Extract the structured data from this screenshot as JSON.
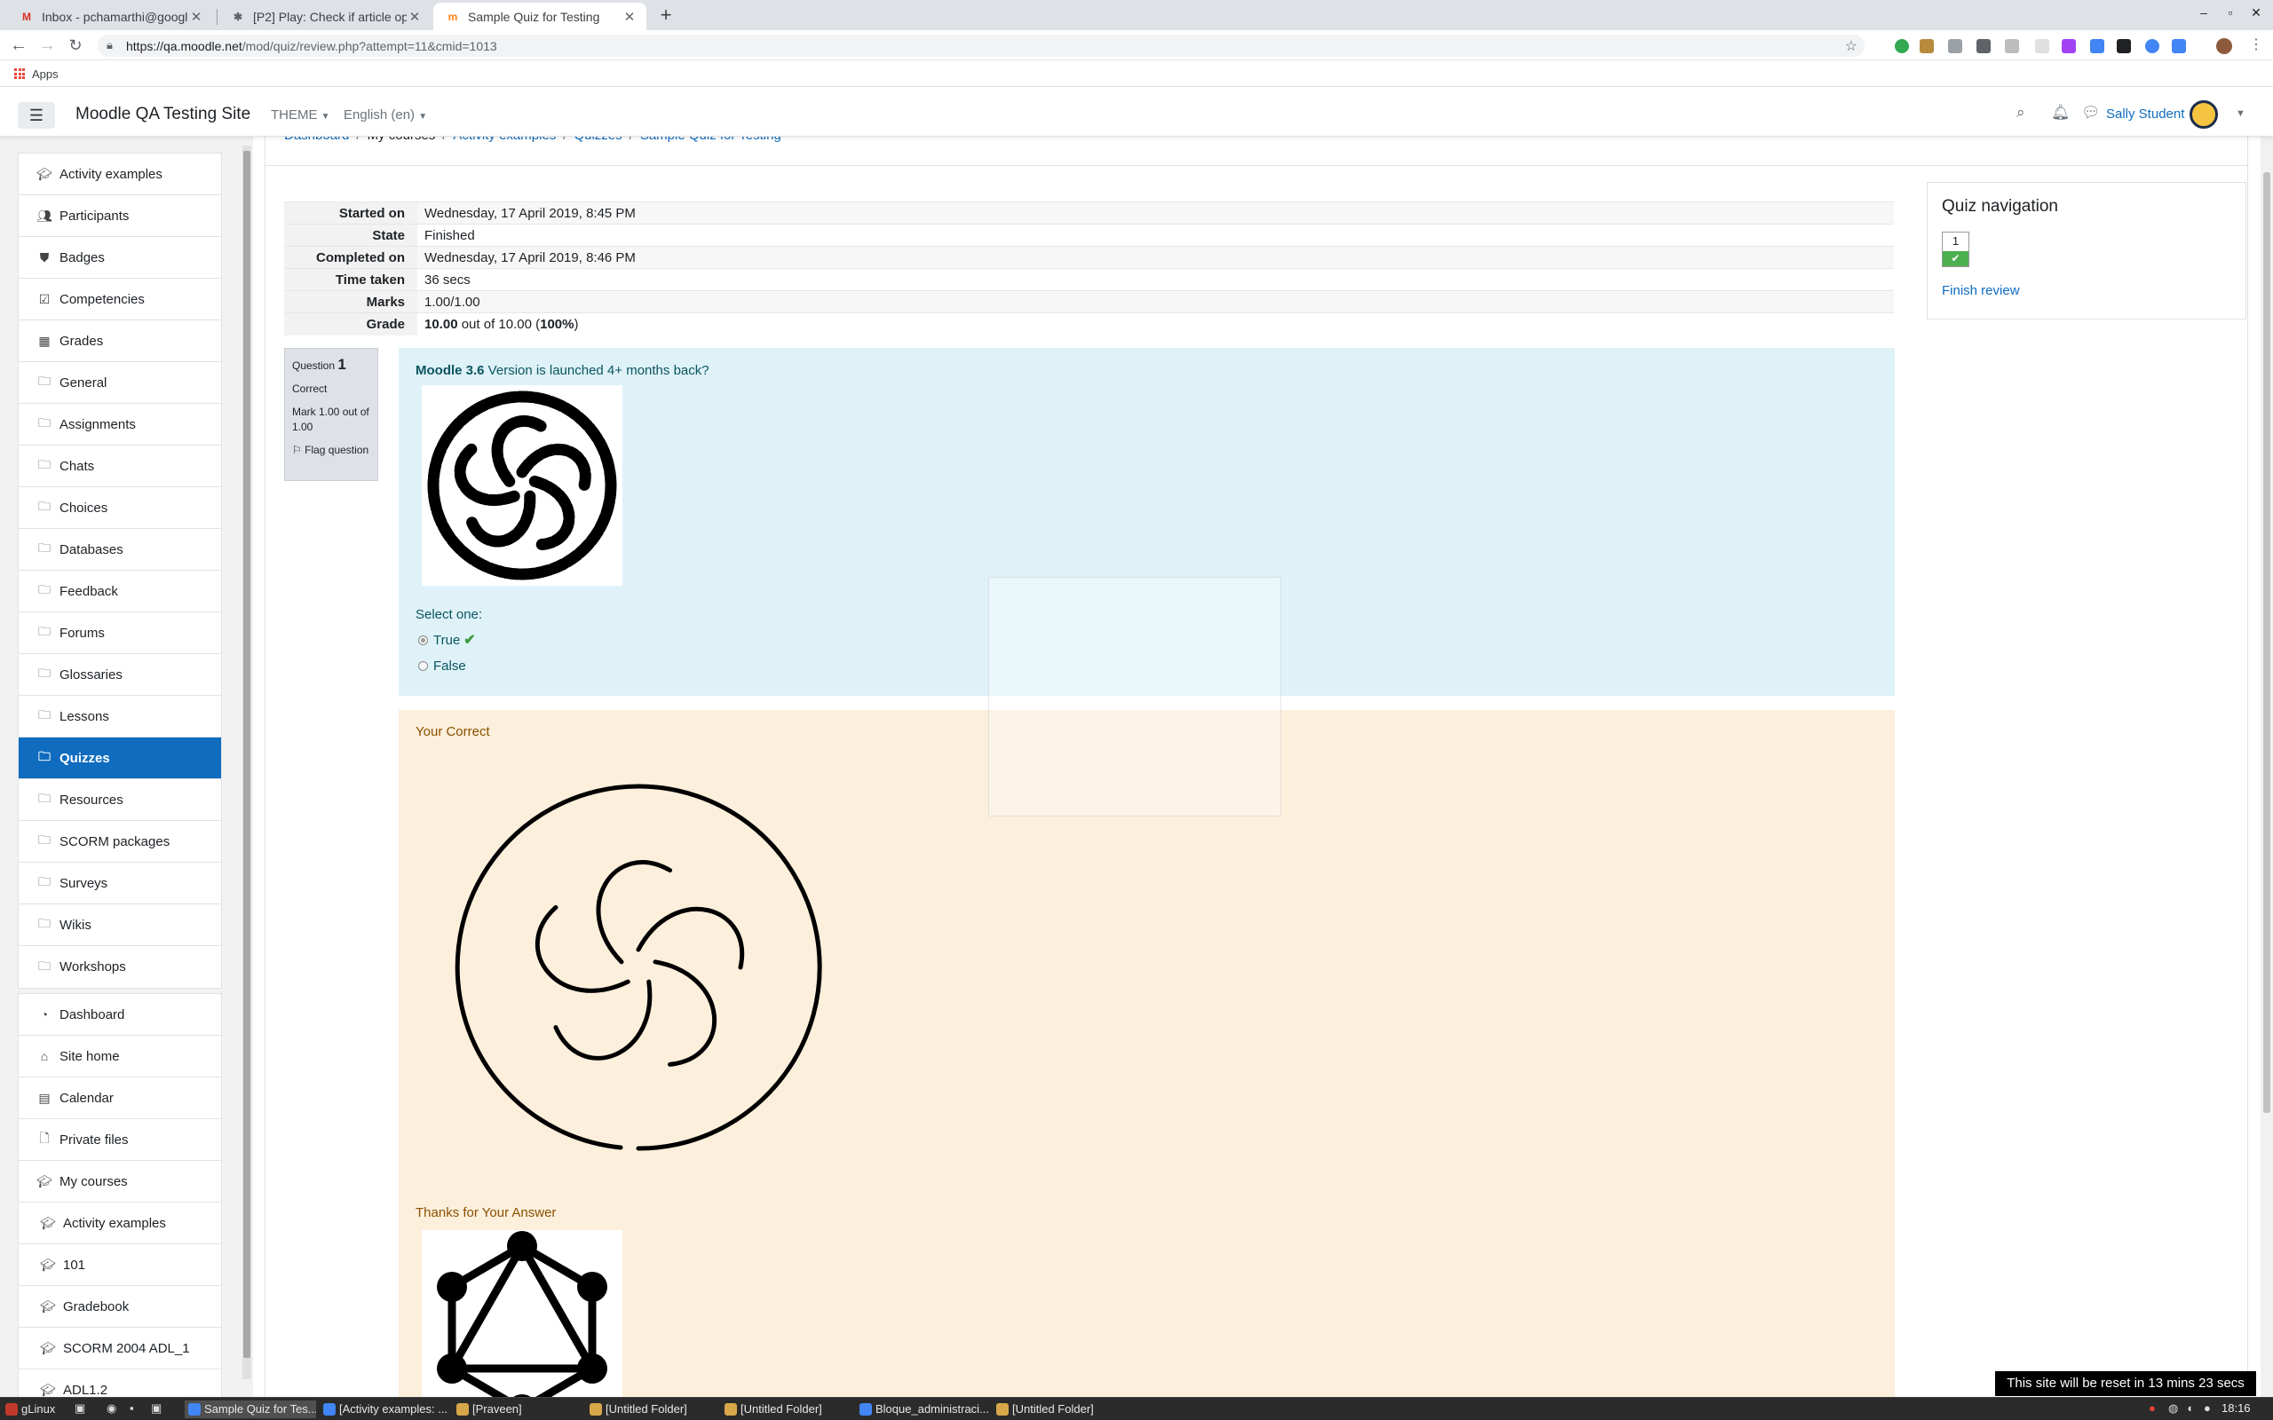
{
  "browser": {
    "tabs": [
      {
        "title": "Inbox - pchamarthi@google.",
        "icon": "gmail-icon"
      },
      {
        "title": "[P2] Play: Check if article op",
        "icon": "bug-icon"
      },
      {
        "title": "Sample Quiz for Testing",
        "icon": "moodle-icon"
      }
    ],
    "url_host": "https://qa.moodle.net",
    "url_path": "/mod/quiz/review.php?attempt=11&cmid=1013",
    "bookmarks_apps": "Apps"
  },
  "navbar": {
    "site_name": "Moodle QA Testing Site",
    "theme_menu": "THEME",
    "language_menu": "English (en)",
    "user_name": "Sally Student"
  },
  "drawer": {
    "course_items": [
      {
        "label": "Activity examples",
        "icon": "graduation-cap-icon"
      },
      {
        "label": "Participants",
        "icon": "users-icon"
      },
      {
        "label": "Badges",
        "icon": "shield-icon"
      },
      {
        "label": "Competencies",
        "icon": "check-square-icon"
      },
      {
        "label": "Grades",
        "icon": "table-icon"
      },
      {
        "label": "General",
        "icon": "folder-icon"
      },
      {
        "label": "Assignments",
        "icon": "folder-icon"
      },
      {
        "label": "Chats",
        "icon": "folder-icon"
      },
      {
        "label": "Choices",
        "icon": "folder-icon"
      },
      {
        "label": "Databases",
        "icon": "folder-icon"
      },
      {
        "label": "Feedback",
        "icon": "folder-icon"
      },
      {
        "label": "Forums",
        "icon": "folder-icon"
      },
      {
        "label": "Glossaries",
        "icon": "folder-icon"
      },
      {
        "label": "Lessons",
        "icon": "folder-icon"
      },
      {
        "label": "Quizzes",
        "icon": "folder-icon",
        "active": true
      },
      {
        "label": "Resources",
        "icon": "folder-icon"
      },
      {
        "label": "SCORM packages",
        "icon": "folder-icon"
      },
      {
        "label": "Surveys",
        "icon": "folder-icon"
      },
      {
        "label": "Wikis",
        "icon": "folder-icon"
      },
      {
        "label": "Workshops",
        "icon": "folder-icon"
      }
    ],
    "site_items": [
      {
        "label": "Dashboard",
        "icon": "dashboard-icon"
      },
      {
        "label": "Site home",
        "icon": "home-icon"
      },
      {
        "label": "Calendar",
        "icon": "calendar-icon"
      },
      {
        "label": "Private files",
        "icon": "file-icon"
      },
      {
        "label": "My courses",
        "icon": "graduation-cap-icon"
      },
      {
        "label": "Activity examples",
        "icon": "graduation-cap-icon"
      },
      {
        "label": "101",
        "icon": "graduation-cap-icon"
      },
      {
        "label": "Gradebook",
        "icon": "graduation-cap-icon"
      },
      {
        "label": "SCORM 2004 ADL_1",
        "icon": "graduation-cap-icon"
      },
      {
        "label": "ADL1.2",
        "icon": "graduation-cap-icon"
      }
    ]
  },
  "breadcrumb": [
    "Dashboard",
    "My courses",
    "Activity examples",
    "Quizzes",
    "Sample Quiz for Testing"
  ],
  "summary": [
    {
      "label": "Started on",
      "value": "Wednesday, 17 April 2019, 8:45 PM"
    },
    {
      "label": "State",
      "value": "Finished"
    },
    {
      "label": "Completed on",
      "value": "Wednesday, 17 April 2019, 8:46 PM"
    },
    {
      "label": "Time taken",
      "value": "36 secs"
    },
    {
      "label": "Marks",
      "value": "1.00/1.00"
    },
    {
      "label": "Grade",
      "value_bold": "10.00",
      "value_rest": " out of 10.00 (",
      "value_pct": "100%",
      "value_end": ")"
    }
  ],
  "question": {
    "label": "Question",
    "number": "1",
    "state": "Correct",
    "mark": "Mark 1.00 out of 1.00",
    "flag": "Flag question",
    "text_bold": "Moodle 3.6",
    "text_rest": " Version is launched 4+ months back?",
    "select_one": "Select one:",
    "options": [
      {
        "label": "True",
        "checked": true,
        "correct": true
      },
      {
        "label": "False",
        "checked": false,
        "correct": false
      }
    ]
  },
  "feedback": {
    "correct_text": "Your Correct",
    "thanks_text": "Thanks for Your Answer"
  },
  "quiz_navigation": {
    "title": "Quiz navigation",
    "question_button": "1",
    "finish_review": "Finish review"
  },
  "reset_notice": "This site will be reset in 13 mins 23 secs",
  "taskbar": {
    "start": "gLinux",
    "items": [
      "Sample Quiz for Tes...",
      "[Activity examples: ...",
      "[Praveen]",
      "[Untitled Folder]",
      "[Untitled Folder]",
      "Bloque_administraci...",
      "[Untitled Folder]"
    ],
    "clock": "18:16"
  }
}
